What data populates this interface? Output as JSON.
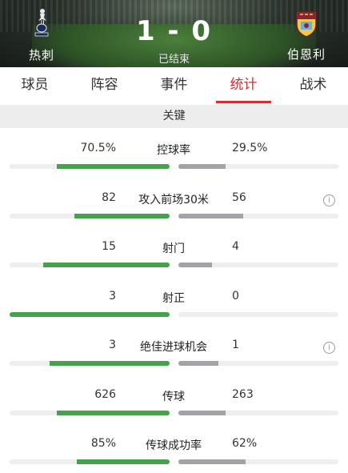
{
  "match": {
    "home_team": "热刺",
    "away_team": "伯恩利",
    "score": "1 - 0",
    "status": "已结束"
  },
  "tabs": [
    {
      "label": "球员"
    },
    {
      "label": "阵容"
    },
    {
      "label": "事件"
    },
    {
      "label": "统计",
      "active": true
    },
    {
      "label": "战术"
    }
  ],
  "section": {
    "title": "关键"
  },
  "colors": {
    "home_bar": "#45a24c",
    "away_bar": "#a3a3a7",
    "accent": "#d52d33"
  },
  "stats": [
    {
      "label": "控球率",
      "home": "70.5%",
      "away": "29.5%",
      "home_fraction": 0.705,
      "away_fraction": 0.295,
      "info": false
    },
    {
      "label": "攻入前场30米",
      "home": "82",
      "away": "56",
      "home_fraction": 0.594,
      "away_fraction": 0.406,
      "info": true
    },
    {
      "label": "射门",
      "home": "15",
      "away": "4",
      "home_fraction": 0.79,
      "away_fraction": 0.21,
      "info": false
    },
    {
      "label": "射正",
      "home": "3",
      "away": "0",
      "home_fraction": 1.0,
      "away_fraction": 0.0,
      "info": false
    },
    {
      "label": "绝佳进球机会",
      "home": "3",
      "away": "1",
      "home_fraction": 0.75,
      "away_fraction": 0.25,
      "info": true
    },
    {
      "label": "传球",
      "home": "626",
      "away": "263",
      "home_fraction": 0.704,
      "away_fraction": 0.296,
      "info": false
    },
    {
      "label": "传球成功率",
      "home": "85%",
      "away": "62%",
      "home_fraction": 0.58,
      "away_fraction": 0.42,
      "info": false
    }
  ]
}
